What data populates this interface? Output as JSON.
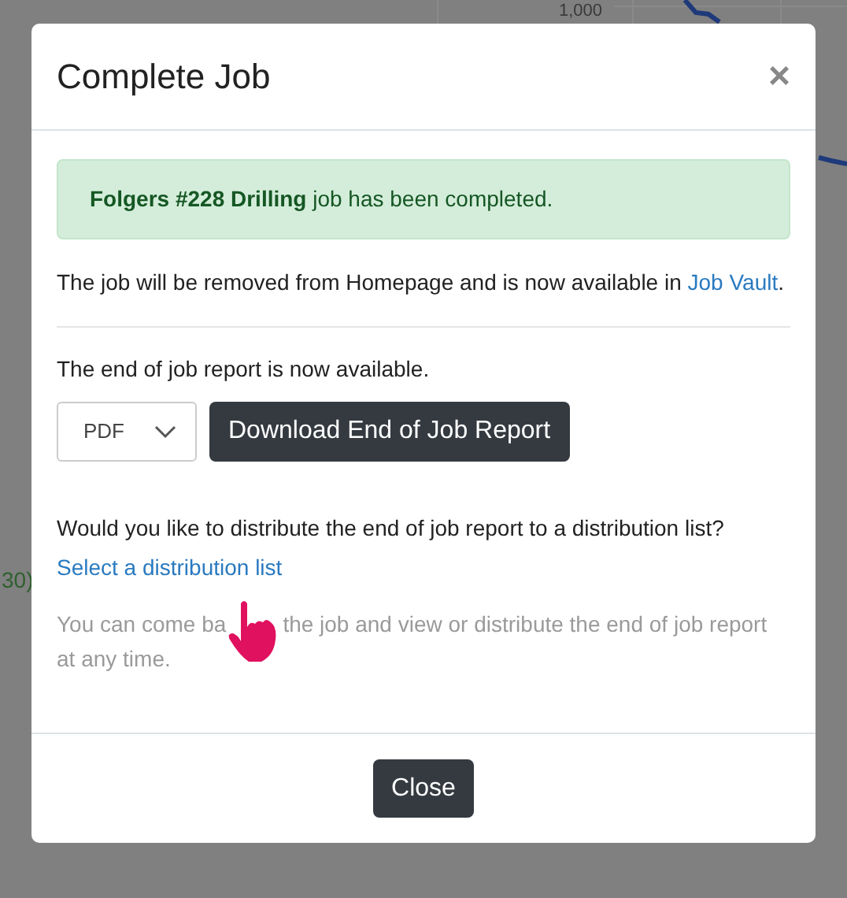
{
  "background": {
    "axis_label": "1,000",
    "side_text": "30)"
  },
  "dialog": {
    "title": "Complete Job",
    "close": "×",
    "alert": "**Folgers #228 Drilling** job has been completed.",
    "removal_note": {
      "text": "The job will be removed from Homepage and is now available in ",
      "link": "Job Vault",
      "end": "."
    },
    "report_note": "The end of job report is now available.",
    "format_select": {
      "value": "PDF"
    },
    "download_button": "Download End of Job Report",
    "distribute_question": "Would you like to distribute the end of job report to a distribution list?",
    "distribute_link": "Select a distribution list",
    "hint_before": "You can come ba",
    "hint_after": "the job and view or distribute the end of job report",
    "hint_last_line": "at any time.",
    "footer_button": "Close"
  }
}
